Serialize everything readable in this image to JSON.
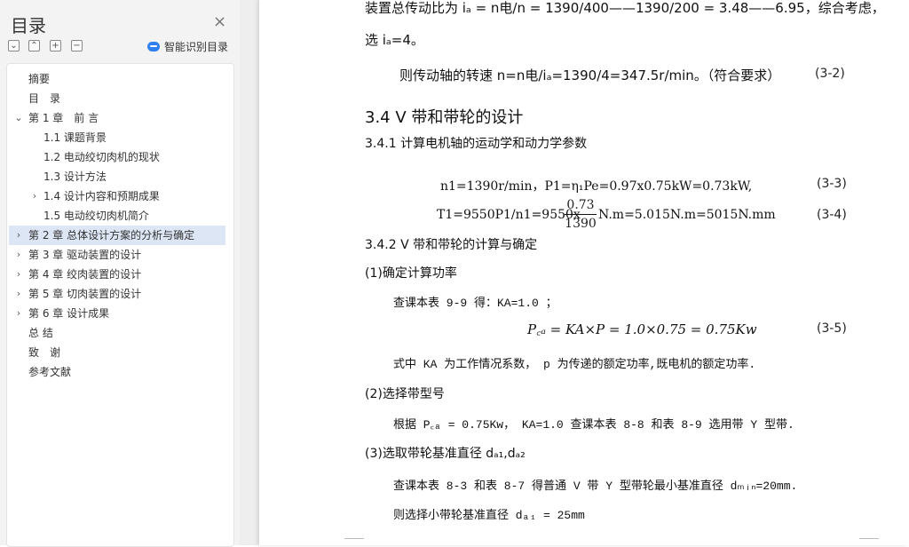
{
  "sidebar": {
    "title": "目录",
    "close": "×",
    "controls": [
      "⌄",
      "⌃",
      "+",
      "−"
    ],
    "smart_toc_label": "智能识别目录",
    "items": [
      {
        "label": "摘要"
      },
      {
        "label": "目　录"
      },
      {
        "label": "第 1 章　前 言",
        "caret": "⌄"
      },
      {
        "label": "1.1 课题背景"
      },
      {
        "label": "1.2 电动绞切肉机的现状"
      },
      {
        "label": "1.3 设计方法"
      },
      {
        "label": "1.4 设计内容和预期成果",
        "caret": "›"
      },
      {
        "label": "1.5 电动绞切肉机简介"
      },
      {
        "label": "第 2 章  总体设计方案的分析与确定",
        "caret": "›",
        "selected": true
      },
      {
        "label": "第 3 章  驱动装置的设计",
        "caret": "›"
      },
      {
        "label": "第 4 章  绞肉装置的设计",
        "caret": "›"
      },
      {
        "label": "第 5 章  切肉装置的设计",
        "caret": "›"
      },
      {
        "label": "第 6 章  设计成果",
        "caret": "›"
      },
      {
        "label": "总 结"
      },
      {
        "label": "致　谢"
      },
      {
        "label": "参考文献"
      }
    ]
  },
  "doc": {
    "line1": "装置总传动比为 iₐ = n电/n = 1390/400——1390/200 = 3.48——6.95，综合考虑，",
    "line2": "选 iₐ=4。",
    "line3": "则传动轴的转速 n=n电/iₐ=1390/4=347.5r/min。（符合要求）",
    "line3_num": "(3-2)",
    "h34": "3.4 V 带和带轮的设计",
    "h341": "3.4.1  计算电机轴的运动学和动力学参数",
    "eq33": "n1=1390r/min，P1=η₁Pe=0.97x0.75kW=0.73kW,",
    "eq33_num": "(3-3)",
    "eq34_left": "T1=9550P1/n1=9550x",
    "eq34_num_top": "0.73",
    "eq34_num_bottom": "1390",
    "eq34_right": "N.m=5.015N.m=5015N.mm",
    "eq34_num": "(3-4)",
    "h342": "3.4.2 V 带和带轮的计算与确定",
    "s1": "(1)确定计算功率",
    "s1_line": "查课本表 9-9 得：KA=1.0 ；",
    "eq35": "P꜀ₐ = KA×P  = 1.0×0.75 = 0.75Kw",
    "eq35_num": "(3-5)",
    "s1_note": "式中 KA 为工作情况系数，   p 为传递的额定功率,既电机的额定功率.",
    "s2": "(2)选择带型号",
    "s2_line": "根据 P꜀ₐ = 0.75Kw， KA=1.0 查课本表 8-8 和表 8-9 选用带 Y 型带.",
    "s3": "(3)选取带轮基准直径 dₐ₁,dₐ₂",
    "s3_line1": "查课本表 8-3 和表 8-7 得普通 V 带 Y 型带轮最小基准直径 dₘᵢₙ=20mm.",
    "s3_line2": "则选择小带轮基准直径 dₐ₁ = 25mm"
  }
}
